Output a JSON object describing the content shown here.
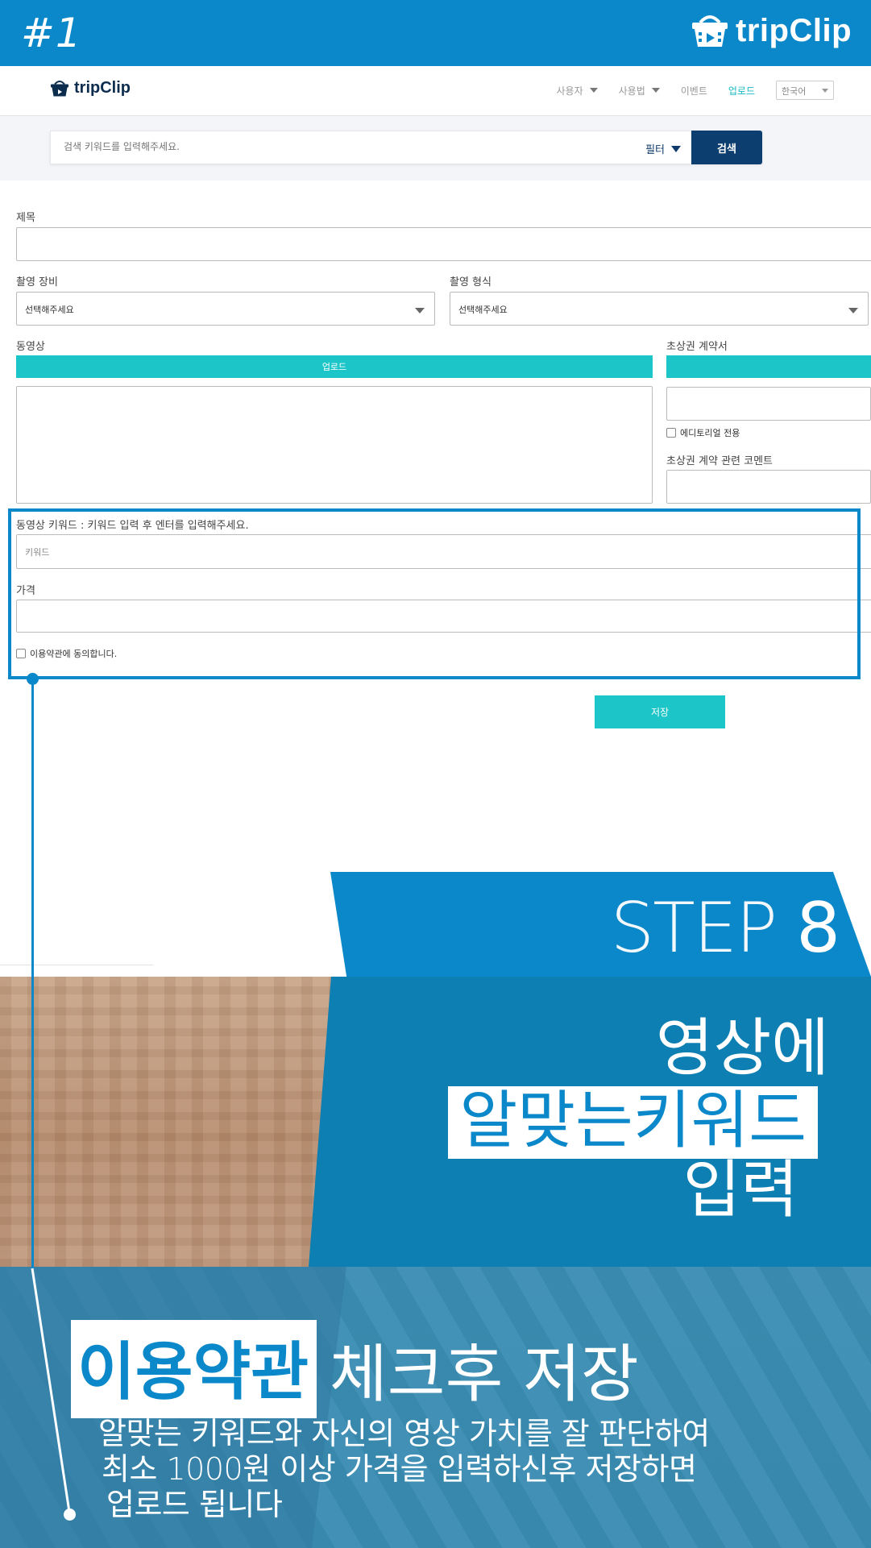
{
  "banner": {
    "step_number": "#1",
    "brand": "tripClip"
  },
  "nav": {
    "brand": "tripClip",
    "menu": [
      {
        "label": "사용자",
        "dropdown": true,
        "active": false
      },
      {
        "label": "사용법",
        "dropdown": true,
        "active": false
      },
      {
        "label": "이벤트",
        "dropdown": false,
        "active": false
      },
      {
        "label": "업로드",
        "dropdown": false,
        "active": true
      }
    ],
    "language": "한국어"
  },
  "search": {
    "placeholder": "검색 키워드를 입력해주세요.",
    "filter_label": "필터",
    "button_label": "검색"
  },
  "form": {
    "title_label": "제목",
    "equipment_label": "촬영 장비",
    "equipment_value": "선택해주세요",
    "format_label": "촬영 형식",
    "format_value": "선택해주세요",
    "video_label": "동영상",
    "upload_button": "업로드",
    "portrait_label": "초상권 계약서",
    "editorial_label": "에디토리얼 전용",
    "portrait_comment_label": "초상권 계약 관련 코멘트",
    "keyword_label": "동영상 키워드 : 키워드 입력 후 엔터를 입력해주세요.",
    "keyword_placeholder": "키워드",
    "price_label": "가격",
    "terms_label": "이용약관에 동의합니다.",
    "save_button": "저장"
  },
  "step": {
    "step_word": "STEP",
    "step_num": "8",
    "headline_1": "영상에",
    "headline_2": "알맞는키워드",
    "headline_3": "입력",
    "sub_highlight": "이용약관",
    "sub_rest": "체크후 저장",
    "desc_1": "알맞는 키워드와 자신의 영상 가치를 잘 판단하여",
    "desc_2": "최소 1000원 이상 가격을 입력하신후 저장하면",
    "desc_3": "업로드 됩니다"
  },
  "colors": {
    "brand_blue": "#0b88c9",
    "teal": "#1cc6c8",
    "navy": "#0d3e70"
  }
}
